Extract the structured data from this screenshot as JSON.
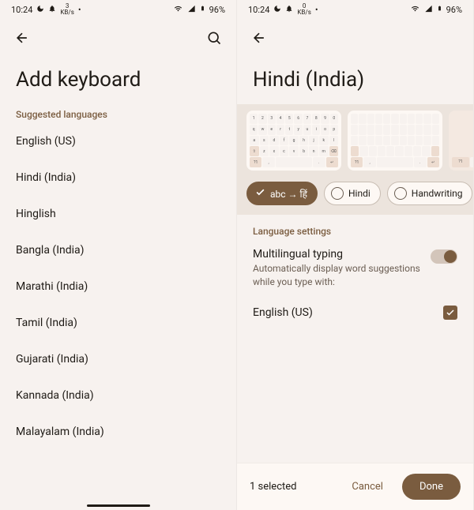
{
  "status": {
    "time": "10:24",
    "net_value": "3",
    "net_unit": "KB/s",
    "net_value2": "0",
    "battery": "96%"
  },
  "left": {
    "title": "Add keyboard",
    "section": "Suggested languages",
    "items": [
      "English (US)",
      "Hindi (India)",
      "Hinglish",
      "Bangla (India)",
      "Marathi (India)",
      "Tamil (India)",
      "Gujarati (India)",
      "Kannada (India)",
      "Malayalam (India)"
    ]
  },
  "right": {
    "title": "Hindi (India)",
    "layouts": [
      {
        "label": "abc → हिं",
        "selected": true
      },
      {
        "label": "Hindi",
        "selected": false
      },
      {
        "label": "Handwriting",
        "selected": false
      }
    ],
    "settings_section": "Language settings",
    "multilingual": {
      "title": "Multilingual typing",
      "subtitle": "Automatically display word suggestions while you type with:",
      "enabled": true
    },
    "langs": [
      {
        "label": "English (US)",
        "checked": true
      }
    ],
    "footer": {
      "selected": "1 selected",
      "cancel": "Cancel",
      "done": "Done"
    }
  }
}
